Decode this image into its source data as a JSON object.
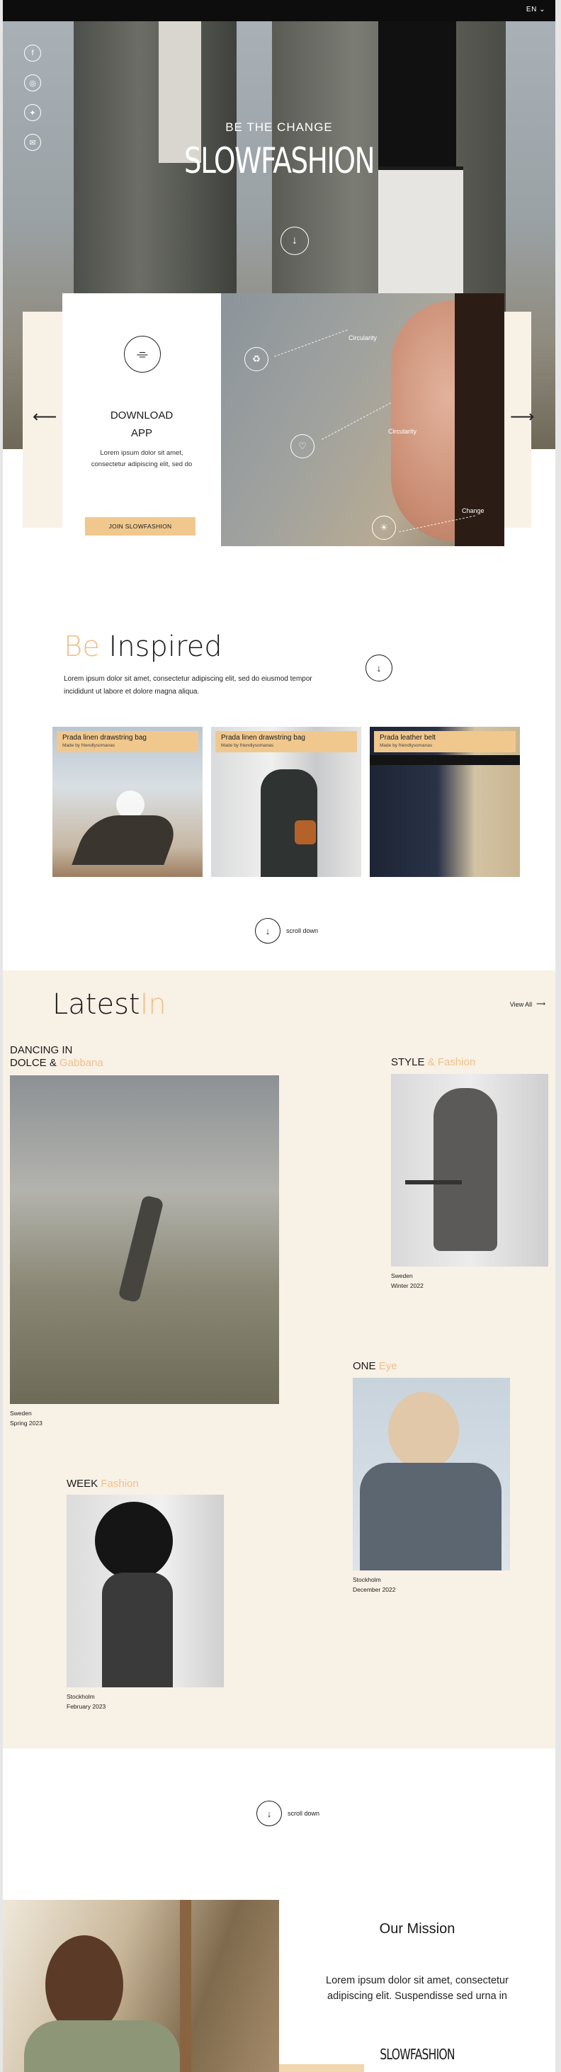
{
  "header": {
    "language": "EN",
    "language_caret": "chevron-down-icon"
  },
  "hero": {
    "subtitle": "BE THE CHANGE",
    "title": "SLOWFASHION",
    "social": [
      "facebook-icon",
      "instagram-icon",
      "twitter-icon",
      "email-icon"
    ]
  },
  "app_card": {
    "title_line1": "DOWNLOAD",
    "title_line2": "APP",
    "text": "Lorem ipsum dolor sit amet, consectetur adipiscing elit, sed do",
    "button": "JOIN SLOWFASHION"
  },
  "photo_panel": {
    "labels": [
      "Circularity",
      "Circularity",
      "Change"
    ]
  },
  "inspired": {
    "title_accent": "Be",
    "title_rest": "Inspired",
    "text": "Lorem ipsum dolor sit amet, consectetur adipiscing elit, sed do eiusmod tempor incididunt ut labore et dolore magna aliqua.",
    "products": [
      {
        "name": "Prada linen drawstring bag",
        "meta": "Made by friendlysomanas"
      },
      {
        "name": "Prada linen drawstring bag",
        "meta": "Made by friendlysomanas"
      },
      {
        "name": "Prada leather belt",
        "meta": "Made by friendlysomanas"
      }
    ],
    "scroll_label": "scroll down"
  },
  "latest": {
    "title_main": "Latest",
    "title_accent": "In",
    "view_all": "View All",
    "items": [
      {
        "title_line1": "DANCING IN",
        "title_line2": "DOLCE &",
        "title_accent": "Gabbana",
        "location": "Sweden",
        "date": "Spring 2023"
      },
      {
        "title_main": "STYLE",
        "title_accent": "& Fashion",
        "location": "Sweden",
        "date": "Winter 2022"
      },
      {
        "title_main": "ONE",
        "title_accent": "Eye",
        "location": "Stockholm",
        "date": "December 2022"
      },
      {
        "title_main": "WEEK",
        "title_accent": "Fashion",
        "location": "Stockholm",
        "date": "February 2023"
      }
    ]
  },
  "scroll2": {
    "label": "scroll down"
  },
  "mission": {
    "title": "Our Mission",
    "text": "Lorem ipsum dolor sit amet, consectetur adipiscing elit. Suspendisse sed urna in",
    "logo": "SLOWFASHION"
  },
  "colors": {
    "accent": "#f0c08a",
    "button": "#f0c88e",
    "cream": "#f8f1e6",
    "dark": "#0d0d0d"
  }
}
